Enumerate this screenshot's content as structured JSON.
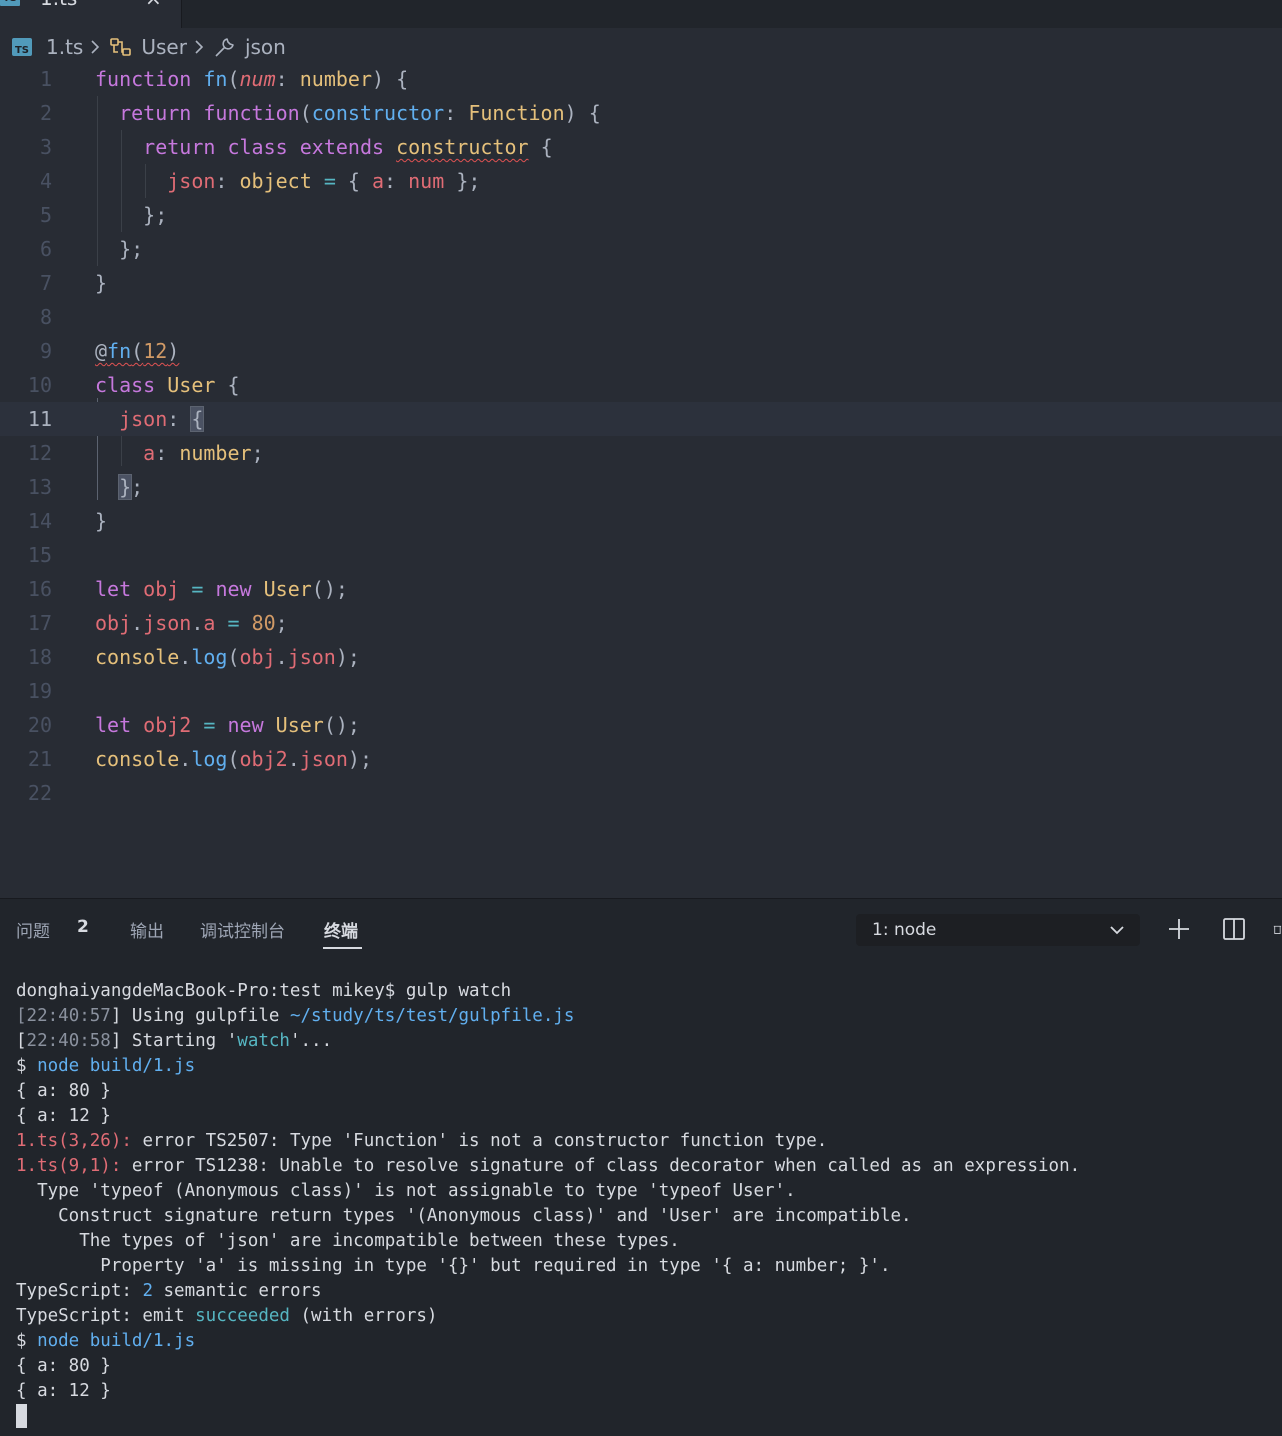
{
  "tab": {
    "label": "1.ts",
    "close": "×",
    "icon": "typescript-file-icon"
  },
  "breadcrumb": {
    "file": "1.ts",
    "class": "User",
    "property": "json"
  },
  "editor": {
    "line_numbers": [
      "1",
      "2",
      "3",
      "4",
      "5",
      "6",
      "7",
      "8",
      "9",
      "10",
      "11",
      "12",
      "13",
      "14",
      "15",
      "16",
      "17",
      "18",
      "19",
      "20",
      "21",
      "22"
    ],
    "active_line": "11"
  },
  "panel": {
    "tabs": {
      "problems": "问题",
      "problems_count": "2",
      "output": "输出",
      "debug_console": "调试控制台",
      "terminal": "终端"
    },
    "terminal_select": "1: node",
    "terminal_lines": [
      "donghaiyangdeMacBook-Pro:test mikey$ gulp watch",
      "[22:40:57] Using gulpfile ~/study/ts/test/gulpfile.js",
      "[22:40:58] Starting 'watch'...",
      "$ node build/1.js",
      "{ a: 80 }",
      "{ a: 12 }",
      "1.ts(3,26): error TS2507: Type 'Function' is not a constructor function type.",
      "1.ts(9,1): error TS1238: Unable to resolve signature of class decorator when called as an expression.",
      "  Type 'typeof (Anonymous class)' is not assignable to type 'typeof User'.",
      "    Construct signature return types '(Anonymous class)' and 'User' are incompatible.",
      "      The types of 'json' are incompatible between these types.",
      "        Property 'a' is missing in type '{}' but required in type '{ a: number; }'.",
      "TypeScript: 2 semantic errors",
      "TypeScript: emit succeeded (with errors)",
      "$ node build/1.js",
      "{ a: 80 }",
      "{ a: 12 }"
    ]
  },
  "colors": {
    "background": "#282c34",
    "panel": "#21252b",
    "keyword": "#c678dd",
    "function": "#61afef",
    "type": "#e5c07b",
    "property": "#e06c75",
    "number": "#d19a66",
    "error": "#e06c75"
  }
}
